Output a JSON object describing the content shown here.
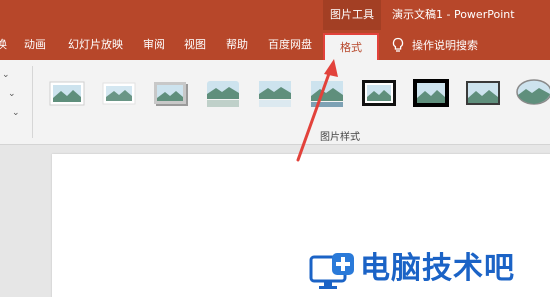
{
  "titlebar": {
    "context_tool": "图片工具",
    "document_title": "演示文稿1  -  PowerPoint"
  },
  "tabs": [
    {
      "label": "换"
    },
    {
      "label": "动画"
    },
    {
      "label": "幻灯片放映"
    },
    {
      "label": "审阅"
    },
    {
      "label": "视图"
    },
    {
      "label": "帮助"
    },
    {
      "label": "百度网盘"
    },
    {
      "label": "格式",
      "active": true
    }
  ],
  "search_hint": {
    "icon": "lightbulb-icon",
    "label": "操作说明搜索"
  },
  "ribbon": {
    "group_label": "图片样式",
    "picture_styles": [
      "simple-frame-white",
      "soft-edge",
      "shadow-rectangle",
      "reflected-rounded",
      "reflected-bevel",
      "perspective-shadow",
      "thick-frame-black",
      "metal-frame-black",
      "simple-frame-black",
      "oval"
    ]
  },
  "colors": {
    "accent": "#b7472a",
    "active_tab_outline": "#e2423b",
    "arrow": "#e2423b",
    "watermark": "#1b63c6"
  },
  "watermark": {
    "text": "电脑技术吧"
  }
}
